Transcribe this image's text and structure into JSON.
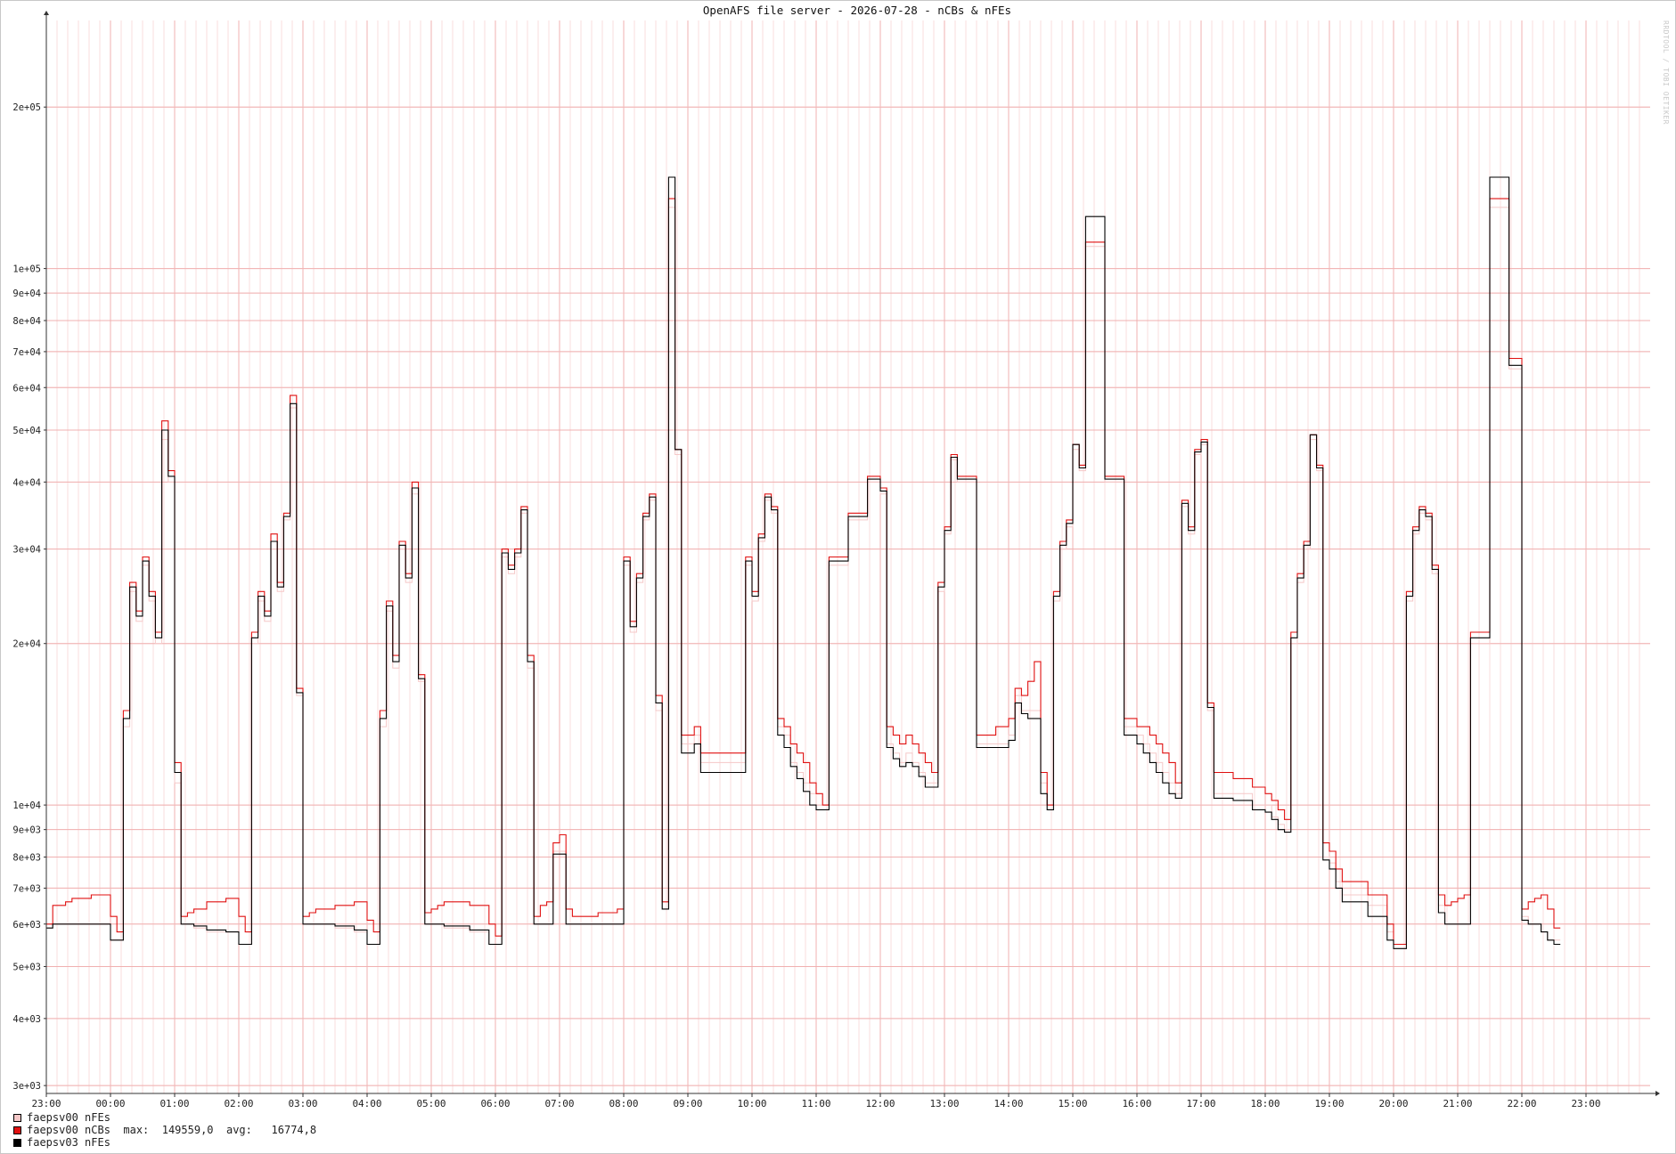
{
  "chart_data": {
    "type": "line",
    "title": "OpenAFS file server - 2026-07-28 - nCBs & nFEs",
    "xlabel": "",
    "ylabel": "",
    "y_scale": "log",
    "ylim": [
      2900,
      290000
    ],
    "grid": true,
    "legend_position": "bottom-left",
    "x_ticks": [
      "23:00",
      "00:00",
      "01:00",
      "02:00",
      "03:00",
      "04:00",
      "05:00",
      "06:00",
      "07:00",
      "08:00",
      "09:00",
      "10:00",
      "11:00",
      "12:00",
      "13:00",
      "14:00",
      "15:00",
      "16:00",
      "17:00",
      "18:00",
      "19:00",
      "20:00",
      "21:00",
      "22:00",
      "23:00"
    ],
    "y_tick_labels": [
      "3e+03",
      "4e+03",
      "5e+03",
      "6e+03",
      "7e+03",
      "8e+03",
      "9e+03",
      "1e+04",
      "2e+04",
      "3e+04",
      "4e+04",
      "5e+04",
      "6e+04",
      "7e+04",
      "8e+04",
      "9e+04",
      "1e+05",
      "2e+05"
    ],
    "y_tick_values": [
      3000,
      4000,
      5000,
      6000,
      7000,
      8000,
      9000,
      10000,
      20000,
      30000,
      40000,
      50000,
      60000,
      70000,
      80000,
      90000,
      100000,
      200000
    ],
    "x_hours": [
      0,
      0.1,
      0.2,
      0.3,
      0.4,
      0.7,
      1.0,
      1.1,
      1.2,
      1.3,
      1.4,
      1.5,
      1.6,
      1.7,
      1.8,
      1.9,
      2.0,
      2.1,
      2.2,
      2.3,
      2.5,
      2.8,
      3.0,
      3.1,
      3.2,
      3.3,
      3.4,
      3.5,
      3.6,
      3.7,
      3.8,
      3.9,
      4.0,
      4.1,
      4.2,
      4.5,
      4.8,
      5.0,
      5.1,
      5.2,
      5.3,
      5.4,
      5.5,
      5.6,
      5.7,
      5.8,
      5.9,
      6.0,
      6.1,
      6.2,
      6.6,
      6.9,
      7.0,
      7.1,
      7.2,
      7.3,
      7.4,
      7.5,
      7.6,
      7.7,
      7.8,
      7.9,
      8.0,
      8.1,
      8.2,
      8.6,
      8.9,
      9.0,
      9.1,
      9.2,
      9.3,
      9.4,
      9.5,
      9.6,
      9.7,
      9.8,
      9.9,
      10.0,
      10.1,
      10.2,
      10.6,
      10.9,
      11.0,
      11.1,
      11.2,
      11.3,
      11.4,
      11.5,
      11.6,
      11.7,
      11.8,
      11.9,
      12.0,
      12.1,
      12.2,
      12.5,
      12.8,
      13.0,
      13.1,
      13.2,
      13.3,
      13.4,
      13.5,
      13.6,
      13.7,
      13.8,
      13.9,
      14.0,
      14.1,
      14.2,
      14.5,
      14.8,
      15.0,
      15.1,
      15.2,
      15.3,
      15.4,
      15.5,
      15.6,
      15.7,
      15.8,
      15.9,
      16.0,
      16.1,
      16.2,
      16.5,
      16.8,
      17.0,
      17.1,
      17.2,
      17.3,
      17.4,
      17.5,
      17.6,
      17.7,
      17.8,
      17.9,
      18.0,
      18.1,
      18.2,
      18.5,
      18.8,
      19.0,
      19.1,
      19.2,
      19.3,
      19.4,
      19.5,
      19.6,
      19.7,
      19.8,
      19.9,
      20.0,
      20.1,
      20.2,
      20.6,
      20.9,
      21.0,
      21.1,
      21.2,
      21.3,
      21.4,
      21.5,
      21.6,
      21.7,
      21.8,
      21.9,
      22.0,
      22.1,
      22.2,
      22.5,
      22.8,
      23.0,
      23.1,
      23.2,
      23.3,
      23.4,
      23.5,
      23.6,
      23.7,
      23.8,
      23.9,
      24.0,
      24.1,
      24.2,
      24.5,
      24.8,
      24.9
    ],
    "series": [
      {
        "name": "faepsv00 nFEs",
        "color": "#f5c8c8",
        "values": [
          5900,
          6000,
          6000,
          6000,
          6000,
          6000,
          5600,
          5600,
          14000,
          25000,
          22000,
          28000,
          24000,
          20000,
          48000,
          40000,
          11000,
          6000,
          6000,
          5900,
          5800,
          5800,
          5500,
          5500,
          20000,
          24000,
          22000,
          30000,
          25000,
          34000,
          55000,
          16000,
          6000,
          6000,
          6000,
          5900,
          5800,
          5500,
          5500,
          14000,
          23000,
          18000,
          30000,
          26000,
          38000,
          17000,
          6000,
          6000,
          6000,
          5900,
          5800,
          5500,
          5500,
          29000,
          27000,
          29000,
          35000,
          18000,
          6000,
          6000,
          6000,
          8200,
          8200,
          6000,
          6000,
          6000,
          6000,
          28000,
          21000,
          26000,
          34000,
          37000,
          15000,
          6400,
          130000,
          45000,
          13000,
          13000,
          13500,
          12000,
          12000,
          28000,
          24000,
          31000,
          37000,
          35000,
          14000,
          13500,
          12000,
          11500,
          11000,
          10500,
          10000,
          10000,
          28000,
          34000,
          40000,
          38000,
          13000,
          12500,
          12000,
          12500,
          12000,
          11500,
          11000,
          11000,
          25000,
          32000,
          44000,
          40000,
          13000,
          13000,
          13500,
          16000,
          15000,
          15000,
          15000,
          11000,
          10000,
          24000,
          30000,
          33000,
          46000,
          42000,
          110000,
          40000,
          14000,
          13500,
          13000,
          12500,
          12000,
          11500,
          11000,
          10500,
          36000,
          32000,
          45000,
          47000,
          15000,
          10500,
          10500,
          10000,
          10000,
          9500,
          9200,
          9000,
          20000,
          26000,
          30000,
          48000,
          42000,
          8000,
          7800,
          7200,
          6800,
          6500,
          5800,
          5400,
          5400,
          24000,
          32000,
          35000,
          34000,
          27000,
          6500,
          6000,
          6000,
          6000,
          6000,
          20000,
          130000,
          65000,
          6200,
          6000,
          6000,
          5800,
          5600,
          5600
        ]
      },
      {
        "name": "faepsv00 nCBs",
        "color": "#e01010",
        "max": "149559,0",
        "avg": "16774,8",
        "values": [
          6000,
          6500,
          6500,
          6600,
          6700,
          6800,
          6200,
          5800,
          15000,
          26000,
          23000,
          29000,
          25000,
          21000,
          52000,
          42000,
          12000,
          6200,
          6300,
          6400,
          6600,
          6700,
          6200,
          5800,
          21000,
          25000,
          23000,
          32000,
          26000,
          35000,
          58000,
          16500,
          6200,
          6300,
          6400,
          6500,
          6600,
          6100,
          5800,
          15000,
          24000,
          19000,
          31000,
          27000,
          40000,
          17500,
          6300,
          6400,
          6500,
          6600,
          6500,
          6000,
          5700,
          30000,
          28000,
          30000,
          36000,
          19000,
          6200,
          6500,
          6600,
          8500,
          8800,
          6400,
          6200,
          6300,
          6400,
          29000,
          22000,
          27000,
          35000,
          38000,
          16000,
          6600,
          135000,
          46000,
          13500,
          13500,
          14000,
          12500,
          12500,
          29000,
          25000,
          32000,
          38000,
          36000,
          14500,
          14000,
          13000,
          12500,
          12000,
          11000,
          10500,
          10000,
          29000,
          35000,
          41000,
          39000,
          14000,
          13500,
          13000,
          13500,
          13000,
          12500,
          12000,
          11500,
          26000,
          33000,
          45000,
          41000,
          13500,
          14000,
          14500,
          16500,
          16000,
          17000,
          18500,
          11500,
          10000,
          25000,
          31000,
          34000,
          47000,
          43000,
          112000,
          41000,
          14500,
          14000,
          14000,
          13500,
          13000,
          12500,
          12000,
          11000,
          37000,
          33000,
          46000,
          48000,
          15500,
          11500,
          11200,
          10800,
          10500,
          10200,
          9800,
          9400,
          21000,
          27000,
          31000,
          49000,
          43000,
          8500,
          8200,
          7600,
          7200,
          6800,
          6000,
          5500,
          5500,
          25000,
          33000,
          36000,
          35000,
          28000,
          6800,
          6500,
          6600,
          6700,
          6800,
          21000,
          135000,
          68000,
          6400,
          6600,
          6700,
          6800,
          6400,
          5900
        ]
      },
      {
        "name": "faepsv03 nFEs",
        "color": "#000000",
        "values": [
          5900,
          6000,
          6000,
          6000,
          6000,
          6000,
          5600,
          5600,
          14500,
          25500,
          22500,
          28500,
          24500,
          20500,
          50000,
          41000,
          11500,
          6000,
          6000,
          5950,
          5850,
          5800,
          5500,
          5500,
          20500,
          24500,
          22500,
          31000,
          25500,
          34500,
          56000,
          16200,
          6000,
          6000,
          6000,
          5950,
          5850,
          5500,
          5500,
          14500,
          23500,
          18500,
          30500,
          26500,
          39000,
          17200,
          6000,
          6000,
          6000,
          5950,
          5850,
          5500,
          5500,
          29500,
          27500,
          29500,
          35500,
          18500,
          6000,
          6000,
          6000,
          8100,
          8100,
          6000,
          6000,
          6000,
          6000,
          28500,
          21500,
          26500,
          34500,
          37500,
          15500,
          6400,
          148000,
          46000,
          12500,
          12500,
          13000,
          11500,
          11500,
          28500,
          24500,
          31500,
          37500,
          35500,
          13500,
          12800,
          11800,
          11200,
          10600,
          10000,
          9800,
          9800,
          28500,
          34500,
          40500,
          38500,
          12800,
          12200,
          11800,
          12000,
          11800,
          11300,
          10800,
          10800,
          25500,
          32500,
          44500,
          40500,
          12800,
          12800,
          13200,
          15500,
          14800,
          14500,
          14500,
          10500,
          9800,
          24500,
          30500,
          33500,
          47000,
          42500,
          125000,
          40500,
          13500,
          13000,
          12500,
          12000,
          11500,
          11000,
          10500,
          10300,
          36500,
          32500,
          45500,
          47500,
          15200,
          10300,
          10200,
          9800,
          9700,
          9400,
          9000,
          8900,
          20500,
          26500,
          30500,
          49000,
          42500,
          7900,
          7600,
          7000,
          6600,
          6200,
          5600,
          5400,
          5400,
          24500,
          32500,
          35500,
          34500,
          27500,
          6300,
          6000,
          6000,
          6000,
          6000,
          20500,
          148000,
          66000,
          6100,
          6000,
          6000,
          5800,
          5600,
          5500
        ]
      }
    ]
  },
  "legend": [
    {
      "label": "faepsv00 nFEs",
      "color": "#f5c8c8",
      "stats": ""
    },
    {
      "label": "faepsv00 nCBs",
      "color": "#e01010",
      "stats": "  max:  149559,0  avg:   16774,8"
    },
    {
      "label": "faepsv03 nFEs",
      "color": "#000000",
      "stats": ""
    }
  ],
  "watermark": "RRDTOOL / TOBI OETIKER"
}
